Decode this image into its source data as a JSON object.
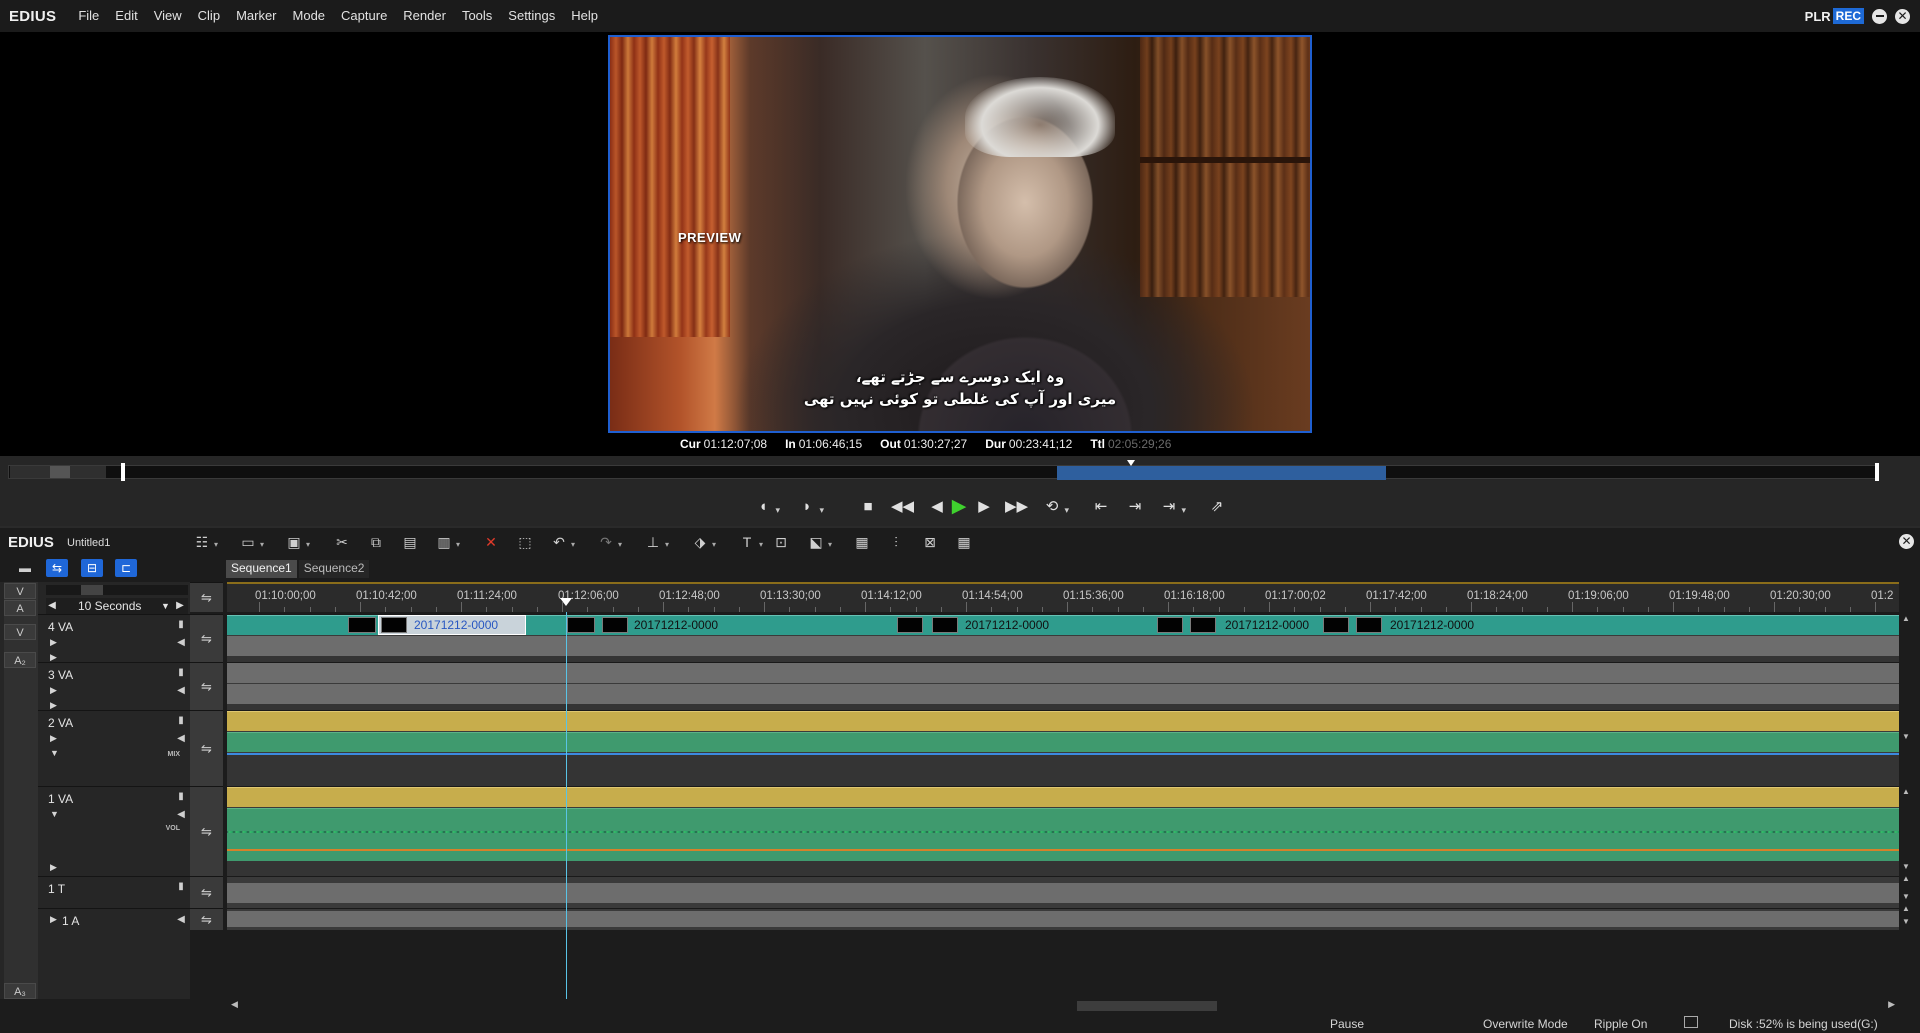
{
  "app": {
    "name": "EDIUS"
  },
  "menu": [
    "File",
    "Edit",
    "View",
    "Clip",
    "Marker",
    "Mode",
    "Capture",
    "Render",
    "Tools",
    "Settings",
    "Help"
  ],
  "mode_indicator": {
    "plr": "PLR",
    "rec": "REC"
  },
  "preview": {
    "label": "PREVIEW",
    "subtitle_line1": "وہ ایک دوسرے سے جڑتے تھے،",
    "subtitle_line2": "میری اور آپ کی غلطی تو کوئی نہیں تھی"
  },
  "timecodes": {
    "cur_label": "Cur",
    "cur_value": "01:12:07;08",
    "in_label": "In",
    "in_value": "01:06:46;15",
    "out_label": "Out",
    "out_value": "01:30:27;27",
    "dur_label": "Dur",
    "dur_value": "00:23:41;12",
    "ttl_label": "Ttl",
    "ttl_value": "02:05:29;26"
  },
  "timeline": {
    "logo": "EDIUS",
    "project": "Untitled1",
    "sequences": [
      "Sequence1",
      "Sequence2"
    ],
    "active_sequence": "Sequence1",
    "scale": "10 Seconds",
    "patch_labels": {
      "v": "V",
      "a": "A",
      "v2": "V",
      "a2": "A₂",
      "a3": "A₃"
    },
    "ruler_labels": [
      "01:10:00;00",
      "01:10:42;00",
      "01:11:24;00",
      "01:12:06;00",
      "01:12:48;00",
      "01:13:30;00",
      "01:14:12;00",
      "01:14:54;00",
      "01:15:36;00",
      "01:16:18;00",
      "01:17:00;02",
      "01:17:42;00",
      "01:18:24;00",
      "01:19:06;00",
      "01:19:48;00",
      "01:20:30;00",
      "01:2"
    ],
    "tracks": [
      {
        "name": "4 VA"
      },
      {
        "name": "3 VA"
      },
      {
        "name": "2 VA",
        "tag": "MIX"
      },
      {
        "name": "1 VA",
        "tag": "VOL"
      },
      {
        "name": "1 T"
      },
      {
        "name": "1 A"
      }
    ],
    "clips_4va": [
      "20171212-0000",
      "20171212-0000",
      "20171212-0000",
      "20171212-0000",
      "20171212-0000"
    ]
  },
  "status": {
    "state": "Pause",
    "mode": "Overwrite Mode",
    "ripple": "Ripple On",
    "disk": "Disk :52% is being used(G:)"
  },
  "colors": {
    "accent_blue": "#1f67d8",
    "clip_teal": "#2f9c8d",
    "clip_yellow": "#c7ad4c",
    "clip_green": "#3f9a6e",
    "play_green": "#3fd12e",
    "range_blue": "#2e5f9e"
  }
}
